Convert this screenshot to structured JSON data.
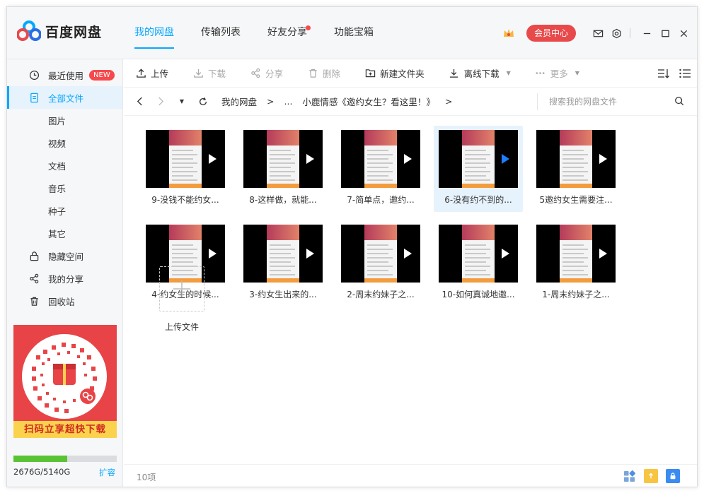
{
  "app": {
    "name": "百度网盘"
  },
  "nav": {
    "tabs": [
      "我的网盘",
      "传输列表",
      "好友分享",
      "功能宝箱"
    ],
    "active": 0
  },
  "header": {
    "vip_label": "会员中心"
  },
  "sidebar": {
    "items": [
      {
        "label": "最近使用",
        "icon": "clock-icon",
        "badge": "NEW"
      },
      {
        "label": "全部文件",
        "icon": "document-icon",
        "active": true
      },
      {
        "label": "图片",
        "sub": true
      },
      {
        "label": "视频",
        "sub": true
      },
      {
        "label": "文档",
        "sub": true
      },
      {
        "label": "音乐",
        "sub": true
      },
      {
        "label": "种子",
        "sub": true
      },
      {
        "label": "其它",
        "sub": true
      },
      {
        "label": "隐藏空间",
        "icon": "lock-icon"
      },
      {
        "label": "我的分享",
        "icon": "share-icon"
      },
      {
        "label": "回收站",
        "icon": "trash-icon"
      }
    ],
    "promo_text": "扫码立享超快下载",
    "storage": {
      "used_text": "2676G/5140G",
      "used_fraction": 0.52,
      "expand_label": "扩容"
    }
  },
  "toolbar": {
    "upload": "上传",
    "download": "下载",
    "share": "分享",
    "delete": "删除",
    "new_folder": "新建文件夹",
    "offline_download": "离线下载",
    "more": "更多"
  },
  "path": {
    "root": "我的网盘",
    "sep": ">",
    "ellipsis": "...",
    "current": "小鹿情感《邀约女生？看这里！》",
    "search_placeholder": "搜索我的网盘文件"
  },
  "files": [
    {
      "name": "9-没钱不能约女..."
    },
    {
      "name": "8-这样做，就能..."
    },
    {
      "name": "7-简单点，邀约..."
    },
    {
      "name": "6-没有约不到的...",
      "selected": true
    },
    {
      "name": "5邀约女生需要注..."
    },
    {
      "name": "4-约女生的时候..."
    },
    {
      "name": "3-约女生出来的..."
    },
    {
      "name": "2-周末约妹子之..."
    },
    {
      "name": "10-如何真诚地邀..."
    },
    {
      "name": "1-周末约妹子之..."
    }
  ],
  "upload_label": "上传文件",
  "status": {
    "count": "10项"
  },
  "colors": {
    "accent": "#06a7ff",
    "vip": "#e8494b",
    "storage": "#5ac335"
  }
}
